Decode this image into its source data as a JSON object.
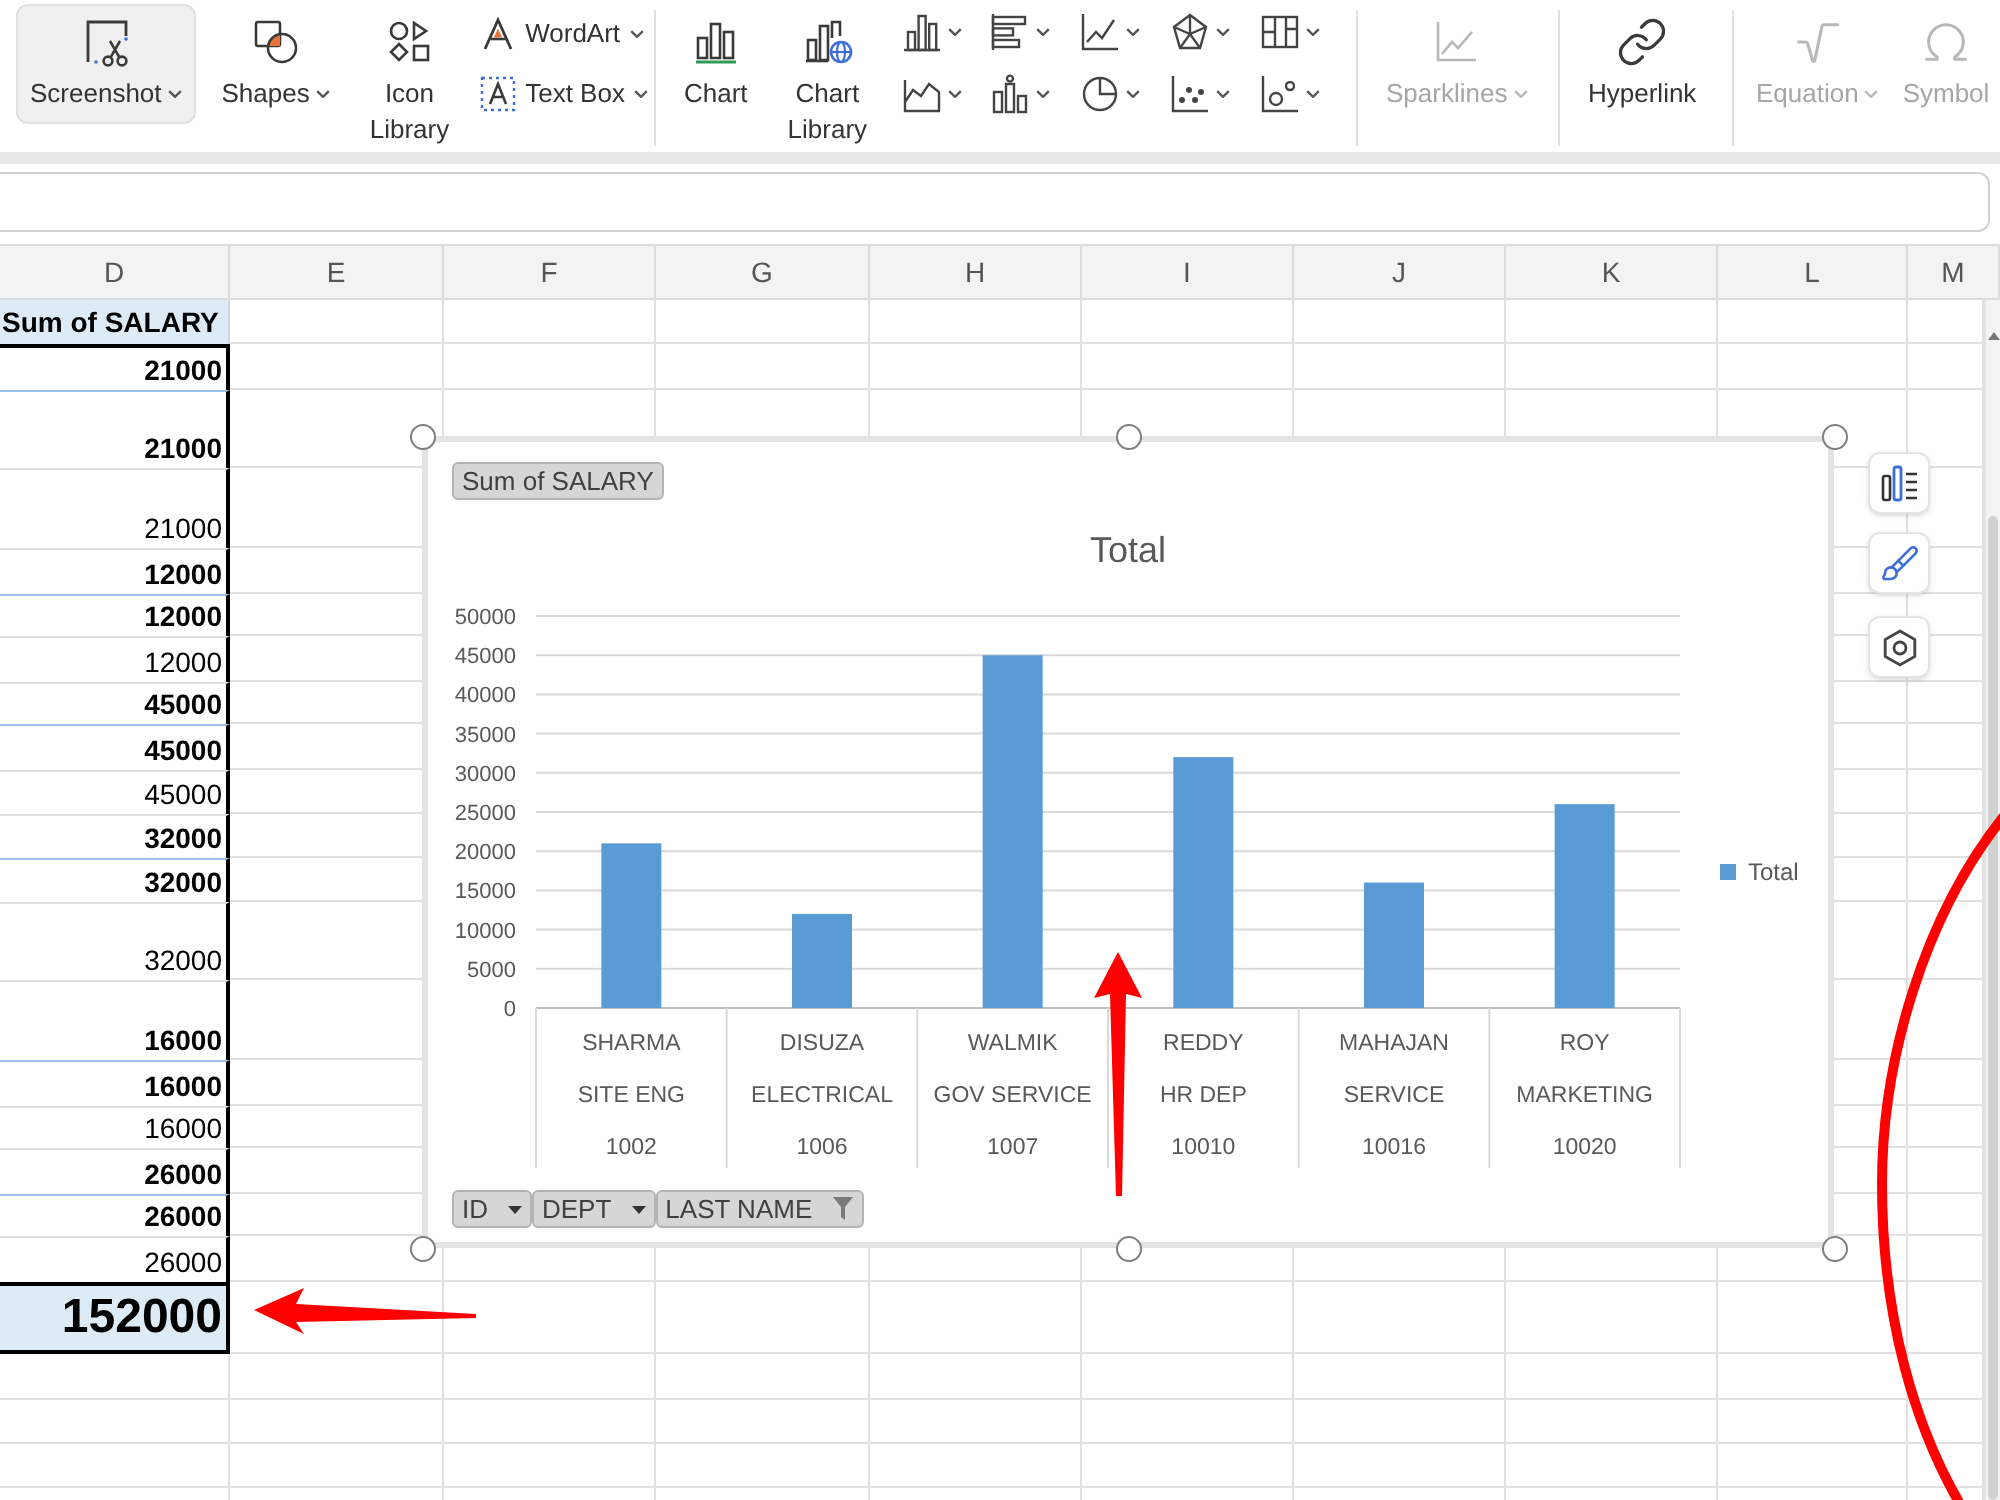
{
  "ribbon": {
    "groups": [
      {
        "items": [
          {
            "kind": "large",
            "label": "Screenshot",
            "dropdown": true,
            "highlighted": true,
            "disabled": false
          },
          {
            "kind": "large",
            "label": "Shapes",
            "dropdown": true,
            "highlighted": false,
            "disabled": false
          },
          {
            "kind": "large",
            "label": "Icon Library",
            "dropdown": false,
            "highlighted": false,
            "disabled": false
          },
          {
            "kind": "stack",
            "items": [
              {
                "label": "WordArt",
                "dropdown": true
              },
              {
                "label": "Text Box",
                "dropdown": true
              }
            ]
          }
        ]
      },
      {
        "items": [
          {
            "kind": "large",
            "label": "Chart",
            "dropdown": false,
            "highlighted": false,
            "disabled": false
          },
          {
            "kind": "large",
            "label": "Chart Library",
            "dropdown": false,
            "highlighted": false,
            "disabled": false
          },
          {
            "kind": "gallery"
          }
        ]
      },
      {
        "items": [
          {
            "kind": "large",
            "label": "Sparklines",
            "dropdown": true,
            "highlighted": false,
            "disabled": true
          }
        ]
      },
      {
        "items": [
          {
            "kind": "large",
            "label": "Hyperlink",
            "dropdown": false,
            "highlighted": false,
            "disabled": false
          }
        ]
      },
      {
        "items": [
          {
            "kind": "large",
            "label": "Equation",
            "dropdown": true,
            "highlighted": false,
            "disabled": true
          },
          {
            "kind": "large",
            "label": "Symbol",
            "dropdown": false,
            "highlighted": false,
            "disabled": true
          }
        ]
      }
    ]
  },
  "sheet": {
    "columns": [
      "D",
      "E",
      "F",
      "G",
      "H",
      "I",
      "J",
      "K",
      "L",
      "M"
    ],
    "pivot": {
      "header": "Sum of SALARY",
      "rows": [
        {
          "kind": "id",
          "value": "21000"
        },
        {
          "kind": "dept",
          "value": "21000"
        },
        {
          "kind": "name",
          "value": "21000"
        },
        {
          "kind": "id",
          "value": "12000"
        },
        {
          "kind": "dept",
          "value": "12000"
        },
        {
          "kind": "name",
          "value": "12000"
        },
        {
          "kind": "id",
          "value": "45000"
        },
        {
          "kind": "dept",
          "value": "45000"
        },
        {
          "kind": "name",
          "value": "45000"
        },
        {
          "kind": "id",
          "value": "32000"
        },
        {
          "kind": "dept",
          "value": "32000"
        },
        {
          "kind": "name",
          "value": "32000"
        },
        {
          "kind": "id",
          "value": "16000"
        },
        {
          "kind": "dept",
          "value": "16000"
        },
        {
          "kind": "name",
          "value": "16000"
        },
        {
          "kind": "id",
          "value": "26000"
        },
        {
          "kind": "dept",
          "value": "26000"
        },
        {
          "kind": "name",
          "value": "26000"
        }
      ],
      "grand_total": "152000"
    }
  },
  "chart": {
    "value_field": "Sum of SALARY",
    "axis_fields": [
      {
        "label": "ID",
        "filtered": false
      },
      {
        "label": "DEPT",
        "filtered": false
      },
      {
        "label": "LAST NAME",
        "filtered": true
      }
    ],
    "chart_data": {
      "type": "bar",
      "title": "Total",
      "categories": [
        [
          "SHARMA",
          "SITE ENG",
          "1002"
        ],
        [
          "DISUZA",
          "ELECTRICAL",
          "1006"
        ],
        [
          "WALMIK",
          "GOV SERVICE",
          "1007"
        ],
        [
          "REDDY",
          "HR DEP",
          "10010"
        ],
        [
          "MAHAJAN",
          "SERVICE",
          "10016"
        ],
        [
          "ROY",
          "MARKETING",
          "10020"
        ]
      ],
      "series": [
        {
          "name": "Total",
          "color": "#5b9bd5",
          "values": [
            21000,
            12000,
            45000,
            32000,
            16000,
            26000
          ]
        }
      ],
      "ylim": [
        0,
        50000
      ],
      "yticks": [
        0,
        5000,
        10000,
        15000,
        20000,
        25000,
        30000,
        35000,
        40000,
        45000,
        50000
      ],
      "grid": true
    }
  }
}
